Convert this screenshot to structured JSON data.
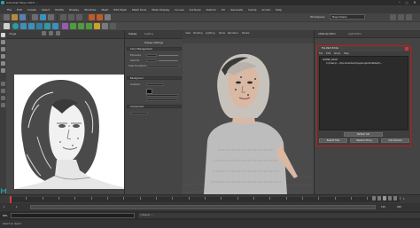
{
  "window": {
    "title": "Autodesk Maya 2024: ...",
    "controls": [
      "–",
      "□",
      "×"
    ]
  },
  "menubar": {
    "items": [
      "File",
      "Edit",
      "Create",
      "Select",
      "Modify",
      "Display",
      "Windows",
      "Mesh",
      "Edit Mesh",
      "Mesh Tools",
      "Mesh Display",
      "Curves",
      "Surfaces",
      "Deform",
      "UV",
      "Generate",
      "Cache",
      "Arnold",
      "Help"
    ]
  },
  "workspace": {
    "label": "Workspace:",
    "value": "Maya Classic"
  },
  "sketch_panel": {
    "header": "Image"
  },
  "attribute_panel": {
    "tabs": [
      "Display",
      "Lighting"
    ],
    "sections": {
      "display_settings": "Display Settings",
      "color_management": "Color Management",
      "background": "Background",
      "component": "Component"
    },
    "fields": {
      "exposure_label": "Exposure",
      "exposure_value": "0.000",
      "gamma_label": "Gamma",
      "gamma_value": "1.000",
      "view_transform_label": "View Transform",
      "view_transform_value": "ACES 1.0 SDR-video",
      "bg_label": "Gradient",
      "bg_value": "Solid Color"
    }
  },
  "viewport": {
    "menus": [
      "View",
      "Shading",
      "Lighting",
      "Show",
      "Renderer",
      "Panels"
    ],
    "colors": {
      "bg": "#4b4b4b",
      "hair": "#c8c2bd",
      "skin": "#d9b8a4",
      "shirt": "#bdbdbd"
    }
  },
  "right_dock": {
    "tabs": [
      "Attribute Editor",
      "Light Editor"
    ]
  },
  "file_path_editor": {
    "title": "File Path Editor",
    "menus": [
      "File",
      "Edit",
      "Show",
      "Help"
    ],
    "tree": [
      "SCENE_ROOT",
      "C:/Users/..../Documents/maya/projects/default/..."
    ],
    "buttons": {
      "refresh": "Refresh List",
      "repath": "Repath Files",
      "replace": "Replace String",
      "auto_resolve": "Auto Resolve"
    }
  },
  "timeline": {
    "start": "1",
    "end": "120",
    "current": "1",
    "range_start": "1",
    "range_end": "200"
  },
  "command_line": {
    "label": "MEL",
    "result": "// Result: ..."
  },
  "help_line": {
    "text": "Select an object"
  },
  "accent": {
    "selection_red": "#c11c1c",
    "maya_blue": "#3c8fbf",
    "maya_teal": "#2a9ca6"
  }
}
